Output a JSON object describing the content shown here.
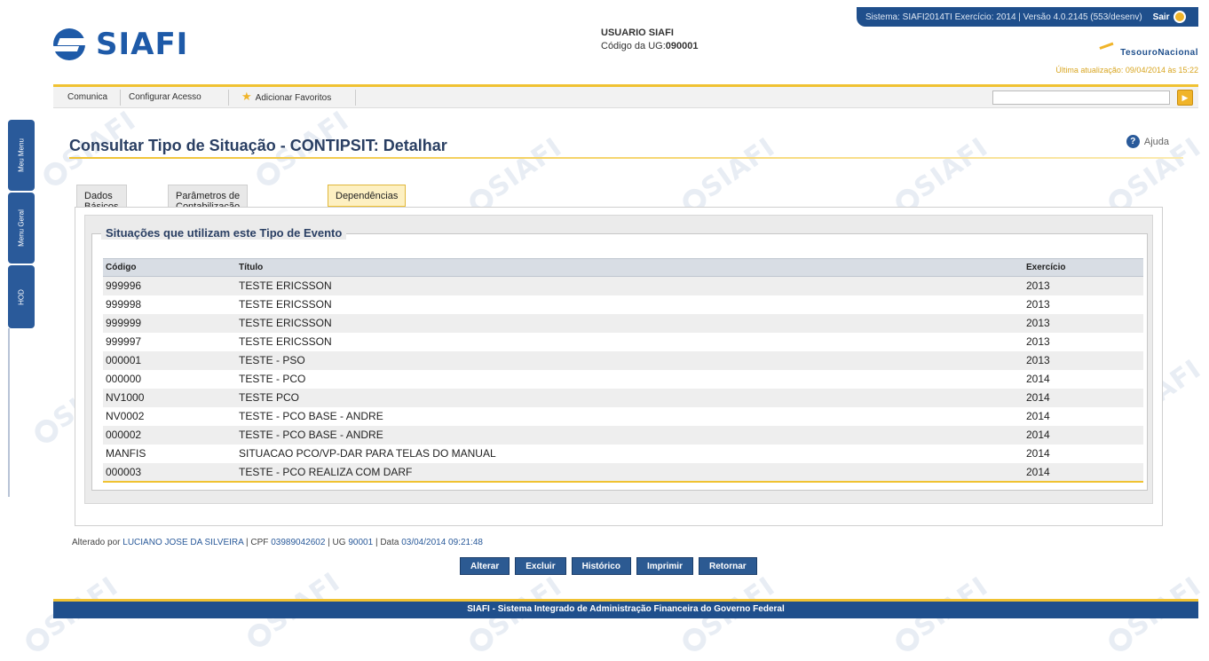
{
  "header": {
    "logo_text": "SIAFI",
    "user_label": "USUARIO SIAFI",
    "ug_prefix": "Código da UG:",
    "ug_code": "090001",
    "system_info": "Sistema: SIAFI2014TI Exercício: 2014 | Versão 4.0.2145 (553/desenv)",
    "logout_label": "Sair",
    "tesouro_label": "TesouroNacional",
    "last_update": "Última atualização: 09/04/2014 às 15:22"
  },
  "menu": {
    "items": [
      "Comunica",
      "Configurar Acesso",
      "Adicionar Favoritos"
    ],
    "search_placeholder": ""
  },
  "sidebar": {
    "tabs": [
      "Meu Menu",
      "Menu Geral",
      "HOD"
    ]
  },
  "page": {
    "title": "Consultar Tipo de Situação - CONTIPSIT: Detalhar",
    "help_label": "Ajuda",
    "tabs": [
      "Dados Básicos",
      "Parâmetros de Contabilização",
      "Dependências"
    ],
    "active_tab": "Dependências",
    "section_title": "Situações que utilizam este Tipo de Evento"
  },
  "table": {
    "headers": [
      "Código",
      "Título",
      "Exercício"
    ],
    "rows": [
      {
        "codigo": "999996",
        "titulo": "TESTE ERICSSON",
        "exercicio": "2013"
      },
      {
        "codigo": "999998",
        "titulo": "TESTE ERICSSON",
        "exercicio": "2013"
      },
      {
        "codigo": "999999",
        "titulo": "TESTE ERICSSON",
        "exercicio": "2013"
      },
      {
        "codigo": "999997",
        "titulo": "TESTE ERICSSON",
        "exercicio": "2013"
      },
      {
        "codigo": "000001",
        "titulo": "TESTE - PSO",
        "exercicio": "2013"
      },
      {
        "codigo": "000000",
        "titulo": "TESTE - PCO",
        "exercicio": "2014"
      },
      {
        "codigo": "NV1000",
        "titulo": "TESTE PCO",
        "exercicio": "2014"
      },
      {
        "codigo": "NV0002",
        "titulo": "TESTE - PCO BASE - ANDRE",
        "exercicio": "2014"
      },
      {
        "codigo": "000002",
        "titulo": "TESTE - PCO BASE - ANDRE",
        "exercicio": "2014"
      },
      {
        "codigo": "MANFIS",
        "titulo": "SITUACAO PCO/VP-DAR PARA TELAS DO MANUAL",
        "exercicio": "2014"
      },
      {
        "codigo": "000003",
        "titulo": "TESTE - PCO REALIZA COM DARF",
        "exercicio": "2014"
      }
    ]
  },
  "audit": {
    "altered_by_label": "Alterado por",
    "user": "LUCIANO JOSE DA SILVEIRA",
    "cpf_label": "| CPF",
    "cpf": "03989042602",
    "ug_label": "| UG",
    "ug": "90001",
    "date_label": "| Data",
    "date": "03/04/2014 09:21:48"
  },
  "actions": [
    "Alterar",
    "Excluir",
    "Histórico",
    "Imprimir",
    "Retornar"
  ],
  "footer": {
    "text": "SIAFI - Sistema Integrado de Administração Financeira do Governo Federal"
  },
  "watermark_text": "SIAFI"
}
